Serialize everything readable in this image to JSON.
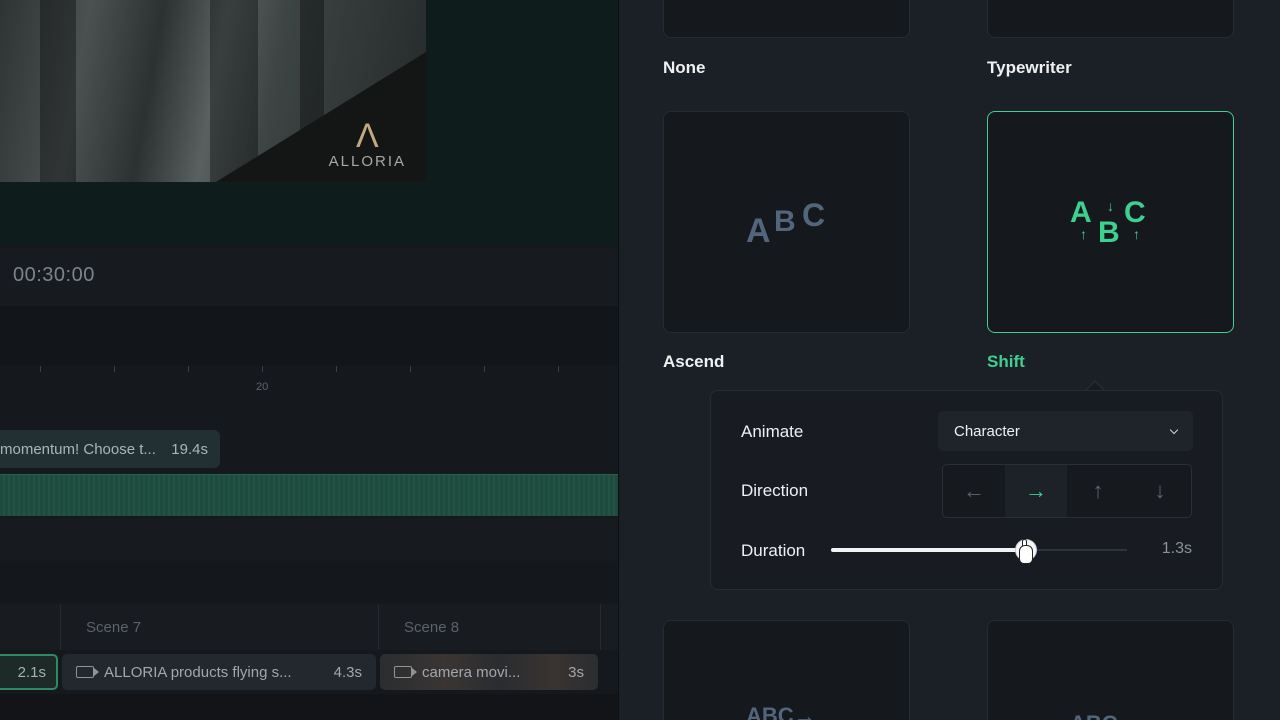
{
  "preview": {
    "logo_text": "ALLORIA",
    "timecode": "00:30:00"
  },
  "timeline": {
    "ruler_label": "20",
    "caption_clip": {
      "text": "momentum! Choose t...",
      "duration": "19.4s"
    },
    "scenes": [
      {
        "label": "Scene 7"
      },
      {
        "label": "Scene 8"
      }
    ],
    "clips": [
      {
        "duration": "2.1s"
      },
      {
        "title": "ALLORIA products flying s...",
        "duration": "4.3s",
        "icon": "video-camera-icon"
      },
      {
        "title": "camera movi...",
        "duration": "3s",
        "icon": "video-camera-icon"
      }
    ]
  },
  "animations": {
    "cards": [
      {
        "label": "None"
      },
      {
        "label": "Typewriter"
      },
      {
        "label": "Ascend",
        "preview": [
          "A",
          "B",
          "C"
        ]
      },
      {
        "label": "Shift",
        "preview": [
          "A",
          "B",
          "C"
        ],
        "selected": true
      }
    ],
    "bottom_previews": [
      "ABC→",
      "ABC"
    ]
  },
  "settings": {
    "animate_label": "Animate",
    "animate_value": "Character",
    "direction_label": "Direction",
    "directions": [
      {
        "name": "left",
        "glyph": "←"
      },
      {
        "name": "right",
        "glyph": "→",
        "active": true
      },
      {
        "name": "up",
        "glyph": "↑"
      },
      {
        "name": "down",
        "glyph": "↓"
      }
    ],
    "duration_label": "Duration",
    "duration_value": "1.3s",
    "duration_fraction": 0.66
  },
  "colors": {
    "accent": "#3ed08f",
    "panel": "#1b1f26"
  }
}
